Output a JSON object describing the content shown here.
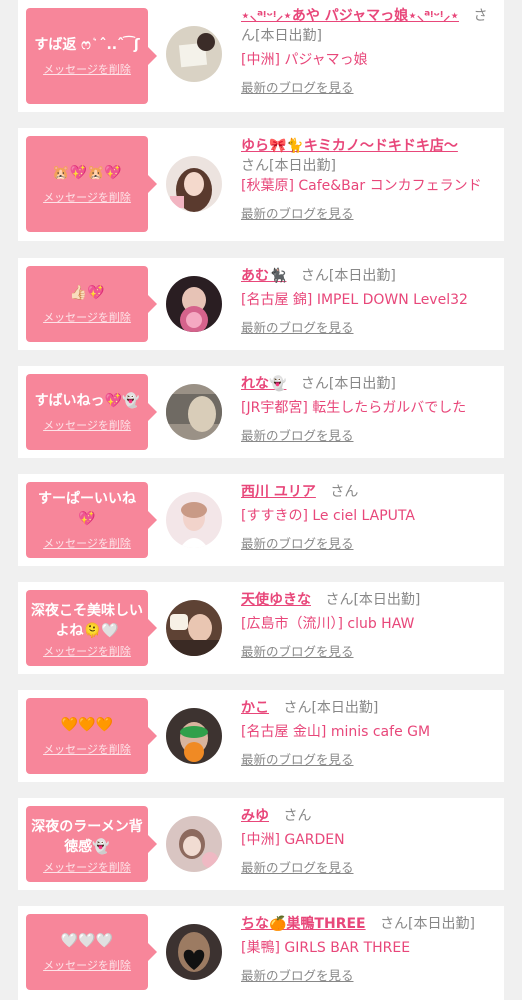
{
  "delete_label": "メッセージを削除",
  "blog_label": "最新のブログを見る",
  "entries": [
    {
      "message": "すば返 ෆ ͛ ˆ..ˆ ͡ ʃ",
      "name": "⋆⸜ᵃᵎᵕᵎ⸝⋆あや パジャマっ娘⋆⸜ᵃᵎᵕᵎ⸝⋆",
      "suffix": "さん[本日出勤]",
      "shop": "[中洲] パジャマっ娘",
      "avatar_color": "#d9d2c4"
    },
    {
      "message": "🐹💖🐹💖",
      "name": "ゆら🎀🐈キミカノ〜ドキドキ店〜",
      "suffix": "さん[本日出勤]",
      "shop": "[秋葉原] Cafe&Bar コンカフェランド",
      "avatar_color": "#e9cfc6"
    },
    {
      "message": "👍🏻💖",
      "name": "あむ🐈‍⬛",
      "suffix": "さん[本日出勤]",
      "shop": "[名古屋 錦] IMPEL DOWN Level32",
      "avatar_color": "#c7889c"
    },
    {
      "message": "すばいねっ💖👻",
      "name": "れな👻",
      "suffix": "さん[本日出勤]",
      "shop": "[JR宇都宮] 転生したらガルバでした",
      "avatar_color": "#b8ad9e"
    },
    {
      "message": "すーぱーいいね💖",
      "name": "西川 ユリア",
      "suffix": "さん",
      "shop": "[すすきの] Le ciel LAPUTA",
      "avatar_color": "#f1dde0"
    },
    {
      "message": "深夜こそ美味しいよね🫠🤍",
      "name": "天使ゆきな",
      "suffix": "さん[本日出勤]",
      "shop": "[広島市（流川）] club HAW",
      "avatar_color": "#8c5f48"
    },
    {
      "message": "🧡🧡🧡",
      "name": "かこ",
      "suffix": "さん[本日出勤]",
      "shop": "[名古屋 金山] minis cafe GM",
      "avatar_color": "#4a3f3a"
    },
    {
      "message": "深夜のラーメン背徳感👻",
      "name": "みゆ",
      "suffix": "さん",
      "shop": "[中洲] GARDEN",
      "avatar_color": "#d6b7b8"
    },
    {
      "message": "🤍🤍🤍",
      "name": "ちな🍊巣鴨THREE",
      "suffix": "さん[本日出勤]",
      "shop": "[巣鴨] GIRLS BAR THREE",
      "avatar_color": "#2c2626"
    }
  ]
}
